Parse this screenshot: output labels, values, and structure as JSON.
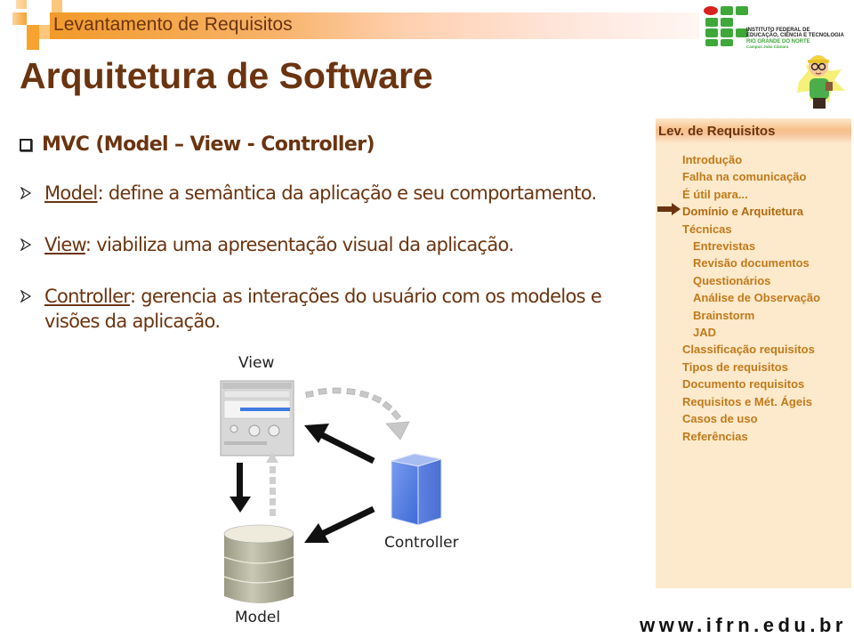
{
  "header": {
    "title": "Levantamento de Requisitos",
    "accent_color": "#f7a330"
  },
  "page_title": "Arquitetura de Software",
  "logo": {
    "line1": "INSTITUTO FEDERAL DE",
    "line2": "EDUCAÇÃO, CIÊNCIA E TECNOLOGIA",
    "line3": "RIO GRANDE DO NORTE",
    "line4": "Campus João Câmara",
    "icon": "ifrn-logo-icon"
  },
  "mascot": {
    "icon": "engineer-mascot-icon"
  },
  "content": {
    "heading": "MVC (Model – View - Controller)",
    "bullets": [
      {
        "term": "Model",
        "text": ": define a semântica da aplicação e seu comportamento."
      },
      {
        "term": "View",
        "text": ": viabiliza uma apresentação visual da aplicação."
      },
      {
        "term": "Controller",
        "text": ": gerencia as interações do usuário com os modelos e visões da aplicação."
      }
    ]
  },
  "diagram": {
    "labels": {
      "view": "View",
      "controller": "Controller",
      "model": "Model"
    },
    "icons": [
      "view-window-icon",
      "controller-cube-icon",
      "model-database-icon"
    ]
  },
  "sidebar": {
    "title": "Lev. de Requisitos",
    "current_index": 3,
    "items": [
      {
        "label": "Introdução",
        "level": 0
      },
      {
        "label": "Falha na comunicação",
        "level": 0
      },
      {
        "label": "É útil para...",
        "level": 0
      },
      {
        "label": "Domínio e Arquitetura",
        "level": 0
      },
      {
        "label": "Técnicas",
        "level": 0
      },
      {
        "label": "Entrevistas",
        "level": 1
      },
      {
        "label": "Revisão documentos",
        "level": 1
      },
      {
        "label": "Questionários",
        "level": 1
      },
      {
        "label": "Análise de Observação",
        "level": 1
      },
      {
        "label": "Brainstorm",
        "level": 1
      },
      {
        "label": "JAD",
        "level": 1
      },
      {
        "label": "Classificação requisitos",
        "level": 0
      },
      {
        "label": "Tipos de requisitos",
        "level": 0
      },
      {
        "label": "Documento requisitos",
        "level": 0
      },
      {
        "label": "Requisitos e Mét. Ágeis",
        "level": 0
      },
      {
        "label": "Casos de uso",
        "level": 0
      },
      {
        "label": "Referências",
        "level": 0
      }
    ]
  },
  "footer": {
    "url": "www.ifrn.edu.br"
  }
}
